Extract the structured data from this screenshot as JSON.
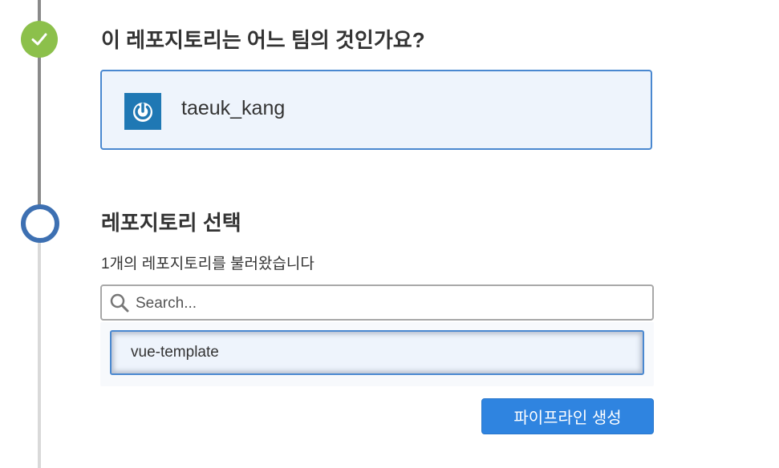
{
  "steps": [
    {
      "title": "이 레포지토리는 어느 팀의 것인가요?",
      "status": "done",
      "status_color": "#8cc04b"
    },
    {
      "title": "레포지토리 선택",
      "status": "current",
      "status_color": "#3d70b2"
    }
  ],
  "team": {
    "name": "taeuk_kang",
    "logo_icon": "power-icon",
    "logo_color": "#1f78b4"
  },
  "repo_select": {
    "loaded_text": "1개의 레포지토리를 불러왔습니다",
    "search_placeholder": "Search...",
    "search_value": "",
    "repos": [
      "vue-template"
    ]
  },
  "actions": {
    "create_label": "파이프라인 생성",
    "create_color": "#2f84e0"
  }
}
